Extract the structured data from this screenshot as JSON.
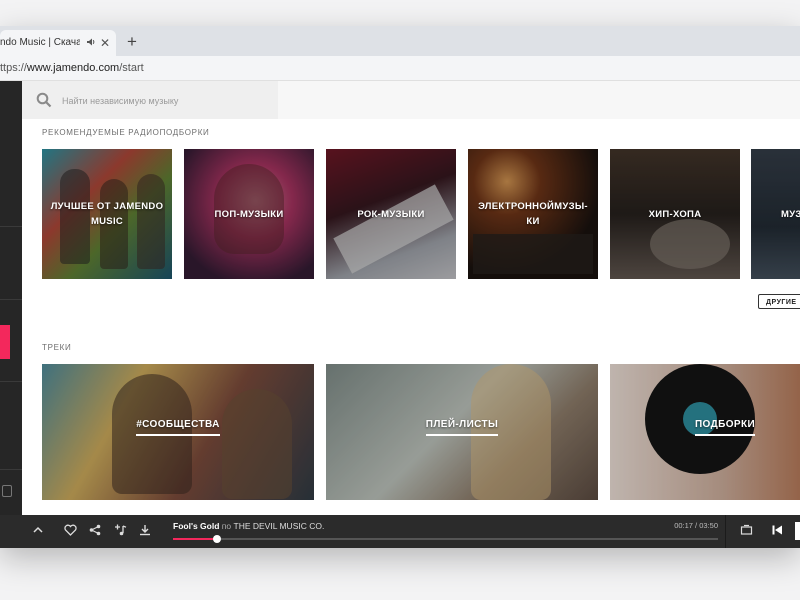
{
  "browser": {
    "tab_title": "ndo Music | Скачать",
    "tab_audio_icon": "speaker-icon",
    "tab_close": "✕",
    "new_tab": "+",
    "url_scheme": "ttps://",
    "url_host": "www.jamendo.com",
    "url_path": "/start"
  },
  "search": {
    "placeholder": "Найти независимую музыку",
    "value": ""
  },
  "radios": {
    "title": "РЕКОМЕНДУЕМЫЕ РАДИОПОДБОРКИ",
    "items": [
      {
        "label": "ЛУЧШЕЕ ОТ JAMENDO MUSIC"
      },
      {
        "label": "ПОП-МУЗЫКИ"
      },
      {
        "label": "РОК-МУЗЫКИ"
      },
      {
        "label": "ЭЛЕКТРОННОЙМУЗЫ-КИ"
      },
      {
        "label": "ХИП-ХОПА"
      },
      {
        "label": "МУЗ"
      }
    ],
    "more_button": "ДРУГИЕ"
  },
  "tracks": {
    "title": "ТРЕКИ",
    "items": [
      {
        "label": "#СООБЩЕСТВА"
      },
      {
        "label": "ПЛЕЙ-ЛИСТЫ"
      },
      {
        "label": "ПОДБОРКИ"
      }
    ]
  },
  "player": {
    "track_title": "Fool's Gold",
    "by": "по",
    "artist": "THE DEVIL MUSIC CO.",
    "time": "00:17 / 03:50",
    "progress": 0.08
  },
  "colors": {
    "accent": "#f3285c",
    "sidebar": "#262626",
    "player": "#2b2b2b"
  }
}
